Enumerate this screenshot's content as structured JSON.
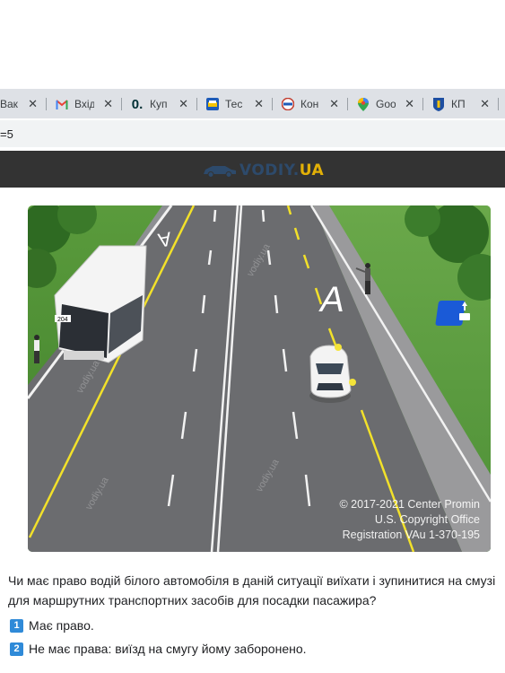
{
  "browser": {
    "tabs": [
      {
        "title": "Вак",
        "icon": "generic-site-icon"
      },
      {
        "title": "Вхід",
        "icon": "gmail-icon"
      },
      {
        "title": "Куп",
        "icon": "olx-icon"
      },
      {
        "title": "Тес",
        "icon": "test-site-icon"
      },
      {
        "title": "Кон",
        "icon": "stop-sign-icon"
      },
      {
        "title": "Goo",
        "icon": "google-maps-icon"
      },
      {
        "title": "КП",
        "icon": "kyiv-coat-of-arms-icon"
      }
    ],
    "close_glyph": "✕",
    "address_fragment": "=5"
  },
  "site": {
    "logo_text": "VODIY.",
    "logo_suffix": "UA"
  },
  "illustration": {
    "bus_number": "204",
    "lane_letter": "A",
    "watermark_lines": [
      "© 2017-2021 Center Promin",
      "U.S. Copyright Office",
      "Registration VAu 1-370-195"
    ],
    "road_watermark": "vodiy.ua"
  },
  "question": {
    "text": "Чи має право водій білого автомобіля в даній ситуації виїхати і зупинитися на смузі для маршрутних транспортних засобів для посадки пасажира?",
    "answers": [
      {
        "num": "1",
        "text": "Має право."
      },
      {
        "num": "2",
        "text": "Не має права: виїзд на смугу йому заборонено."
      }
    ]
  },
  "colors": {
    "tabbar": "#dee1e6",
    "header": "#333333",
    "answer_badge": "#2f8ad8",
    "lane_line_yellow": "#f2e12a"
  }
}
